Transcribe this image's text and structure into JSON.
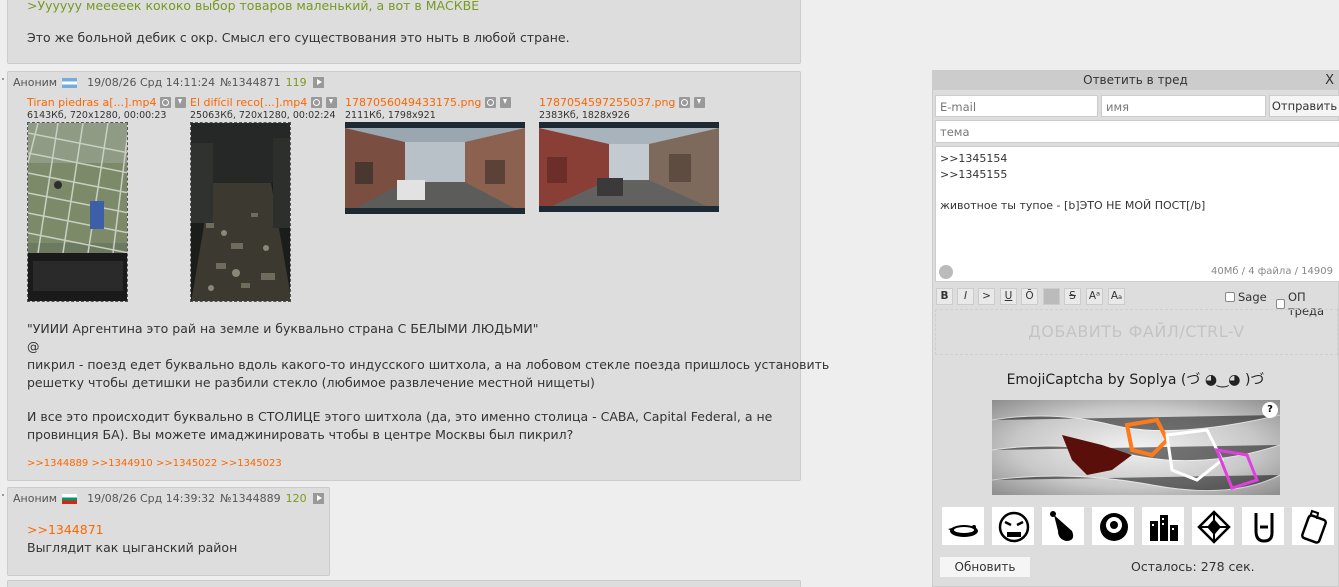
{
  "post_top": {
    "quote": ">Уууууу мееееек кококо выбор товаров маленький, а вот в МАСКВЕ",
    "text": "Это же больной дебик с окр. Смысл его существования это ныть в любой стране."
  },
  "post_main": {
    "name": "Аноним",
    "datetime": "19/08/26 Срд 14:11:24",
    "number": "№1344871",
    "index": "119",
    "files": [
      {
        "name": "Tiran piedras a[...].mp4",
        "info": "6143Кб, 720x1280, 00:00:23"
      },
      {
        "name": "El difícil reco[...].mp4",
        "info": "25063Кб, 720x1280, 00:02:24"
      },
      {
        "name": "1787056049433175.png",
        "info": "2111Кб, 1798x921"
      },
      {
        "name": "1787054597255037.png",
        "info": "2383Кб, 1828x926"
      }
    ],
    "lines": [
      "\"УИИИ Аргентина это рай на земле и буквально страна С БЕЛЫМИ ЛЮДЬМИ\"",
      "@",
      "пикрил - поезд едет буквально вдоль какого-то индусского шитхола, а на лобовом стекле поезда пришлось установить",
      "решетку чтобы детишки не разбили стекло (любимое развлечение местной нищеты)",
      "",
      "И все это происходит буквально в СТОЛИЦЕ этого шитхола (да, это именно столица - CABA, Capital Federal, а не",
      "провинция БА). Вы можете имаджинировать чтобы в центре Москвы был пикрил?"
    ],
    "replies": [
      ">>1344889",
      ">>1344910",
      ">>1345022",
      ">>1345023"
    ]
  },
  "post_reply": {
    "name": "Аноним",
    "datetime": "19/08/26 Срд 14:39:32",
    "number": "№1344889",
    "index": "120",
    "link": ">>1344871",
    "text": "Выглядит как цыганский район"
  },
  "form": {
    "title": "Ответить в тред",
    "close": "X",
    "email_placeholder": "E-mail",
    "name_placeholder": "имя",
    "submit": "Отправить",
    "subject_placeholder": "тема",
    "message_lines": [
      ">>1345154",
      ">>1345155",
      "",
      "животное ты тупое - [b]ЭТО НЕ МОЙ ПОСТ[/b]"
    ],
    "counter": "40Мб / 4 файла / 14909",
    "tools": [
      "B",
      "I",
      ">",
      "U",
      "Ō",
      "",
      "S",
      "Aᵃ",
      "Aₐ"
    ],
    "sage_label": "Sage",
    "op_label": "ОП треда",
    "dropzone": "ДОБАВИТЬ ФАЙЛ/CTRL-V"
  },
  "captcha": {
    "title": "EmojiCaptcha by Soplya (づ ◕‿◕ )づ",
    "help": "?",
    "emoji_names": [
      "platypus-icon",
      "angry-face-icon",
      "drumstick-icon",
      "bowl-icon",
      "city-icon",
      "diamond-cross-icon",
      "rock-hand-icon",
      "luggage-icon"
    ],
    "refresh": "Обновить",
    "remaining": "Осталось: 278 сек."
  }
}
